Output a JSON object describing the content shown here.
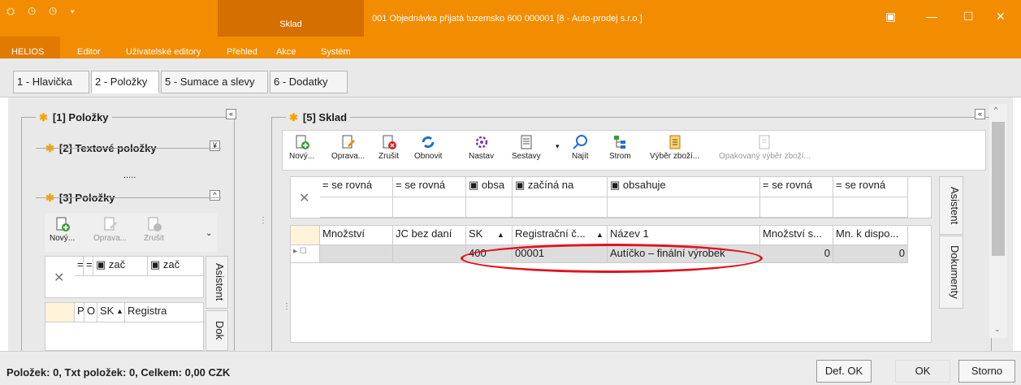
{
  "window": {
    "quick_icons": "⛭ ◷ ◷ ▾",
    "context_tab": "Sklad",
    "document_title": "001 Objednávka přijatá tuzemsko 600 000001 [8 - Auto-prodej s.r.o.]",
    "controls": [
      "▣",
      "—",
      "☐",
      "✕"
    ]
  },
  "menu": [
    "HELIOS",
    "Editor",
    "Uživatelské editory",
    "Přehled",
    "Akce",
    "Systém"
  ],
  "tabs": [
    "1 - Hlavička",
    "2 - Položky",
    "5 - Sumace a slevy",
    "6 - Dodatky"
  ],
  "left_panel": {
    "title1": "[1] Položky",
    "title2": "[2] Textové položky",
    "dots": ".....",
    "title3": "[3] Položky",
    "toolbar": [
      "Nový...",
      "Oprava...",
      "Zrušit"
    ],
    "filter_ops": [
      "=",
      "=",
      "▣ zač",
      "▣ zač"
    ],
    "columns": [
      "P",
      "O",
      "SK",
      "▲",
      "Registra"
    ],
    "side_tabs": [
      "Asistent",
      "Dok"
    ]
  },
  "right_panel": {
    "title": "[5] Sklad",
    "toolbar": [
      "Nový...",
      "Oprava...",
      "Zrušit",
      "Obnovit",
      "Nastav",
      "Sestavy",
      "Najít",
      "Strom",
      "Výběr zboží...",
      "Opakovaný výběr zboží..."
    ],
    "filter_ops": [
      "= se rovná",
      "= se rovná",
      "▣ obsa",
      "▣ začíná na",
      "▣ obsahuje",
      "= se rovná",
      "= se rovná"
    ],
    "columns": [
      "Množství",
      "JC bez daní",
      "SK",
      "▲",
      "Registrační č...",
      "▲",
      "Název 1",
      "Množství s...",
      "Mn. k dispo..."
    ],
    "row": {
      "sk": "400",
      "reg": "00001",
      "name": "Autíčko – finální výrobek",
      "qty": "0",
      "avail": "0"
    },
    "side_tabs": [
      "Asistent",
      "Dokumenty"
    ]
  },
  "status": {
    "text": "Položek: 0,  Txt položek: 0,  Celkem: 0,00 CZK",
    "buttons": [
      "Def. OK",
      "OK",
      "Storno"
    ]
  }
}
